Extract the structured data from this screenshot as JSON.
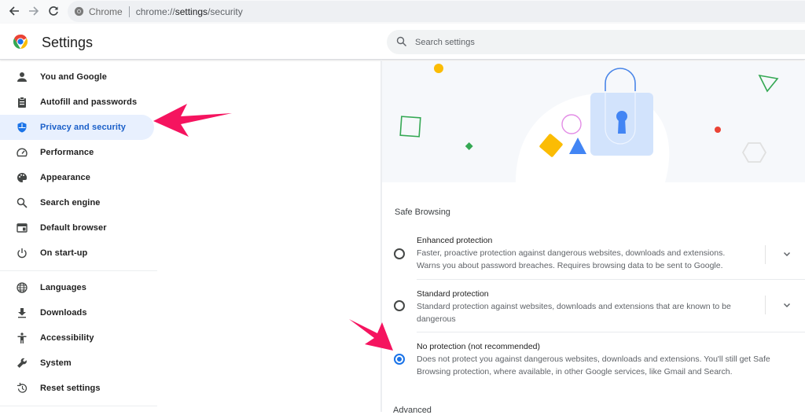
{
  "browser": {
    "back_icon": "arrow-left",
    "forward_icon": "arrow-right",
    "reload_icon": "reload",
    "site_chip": "Chrome",
    "url_prefix": "chrome://",
    "url_host": "settings",
    "url_path": "/security"
  },
  "header": {
    "title": "Settings",
    "search_placeholder": "Search settings"
  },
  "sidebar": {
    "items": [
      {
        "label": "You and Google",
        "icon": "person"
      },
      {
        "label": "Autofill and passwords",
        "icon": "clipboard"
      },
      {
        "label": "Privacy and security",
        "icon": "shield",
        "active": true
      },
      {
        "label": "Performance",
        "icon": "speedometer"
      },
      {
        "label": "Appearance",
        "icon": "palette"
      },
      {
        "label": "Search engine",
        "icon": "search"
      },
      {
        "label": "Default browser",
        "icon": "browser-window"
      },
      {
        "label": "On start-up",
        "icon": "power"
      },
      {
        "label": "Languages",
        "icon": "globe"
      },
      {
        "label": "Downloads",
        "icon": "download"
      },
      {
        "label": "Accessibility",
        "icon": "accessibility"
      },
      {
        "label": "System",
        "icon": "wrench"
      },
      {
        "label": "Reset settings",
        "icon": "history"
      }
    ]
  },
  "main": {
    "section_label": "Safe Browsing",
    "options": [
      {
        "title": "Enhanced protection",
        "description": "Faster, proactive protection against dangerous websites, downloads and extensions. Warns you about password breaches. Requires browsing data to be sent to Google.",
        "selected": false,
        "expandable": true
      },
      {
        "title": "Standard protection",
        "description": "Standard protection against websites, downloads and extensions that are known to be dangerous",
        "selected": false,
        "expandable": true
      },
      {
        "title": "No protection (not recommended)",
        "description": "Does not protect you against dangerous websites, downloads and extensions. You'll still get Safe Browsing protection, where available, in other Google services, like Gmail and Search.",
        "selected": true,
        "expandable": false
      }
    ],
    "advanced_label": "Advanced"
  },
  "colors": {
    "accent": "#1a73e8",
    "active_nav_bg": "#e8f0fe",
    "annotation_arrow": "#f5145f"
  }
}
